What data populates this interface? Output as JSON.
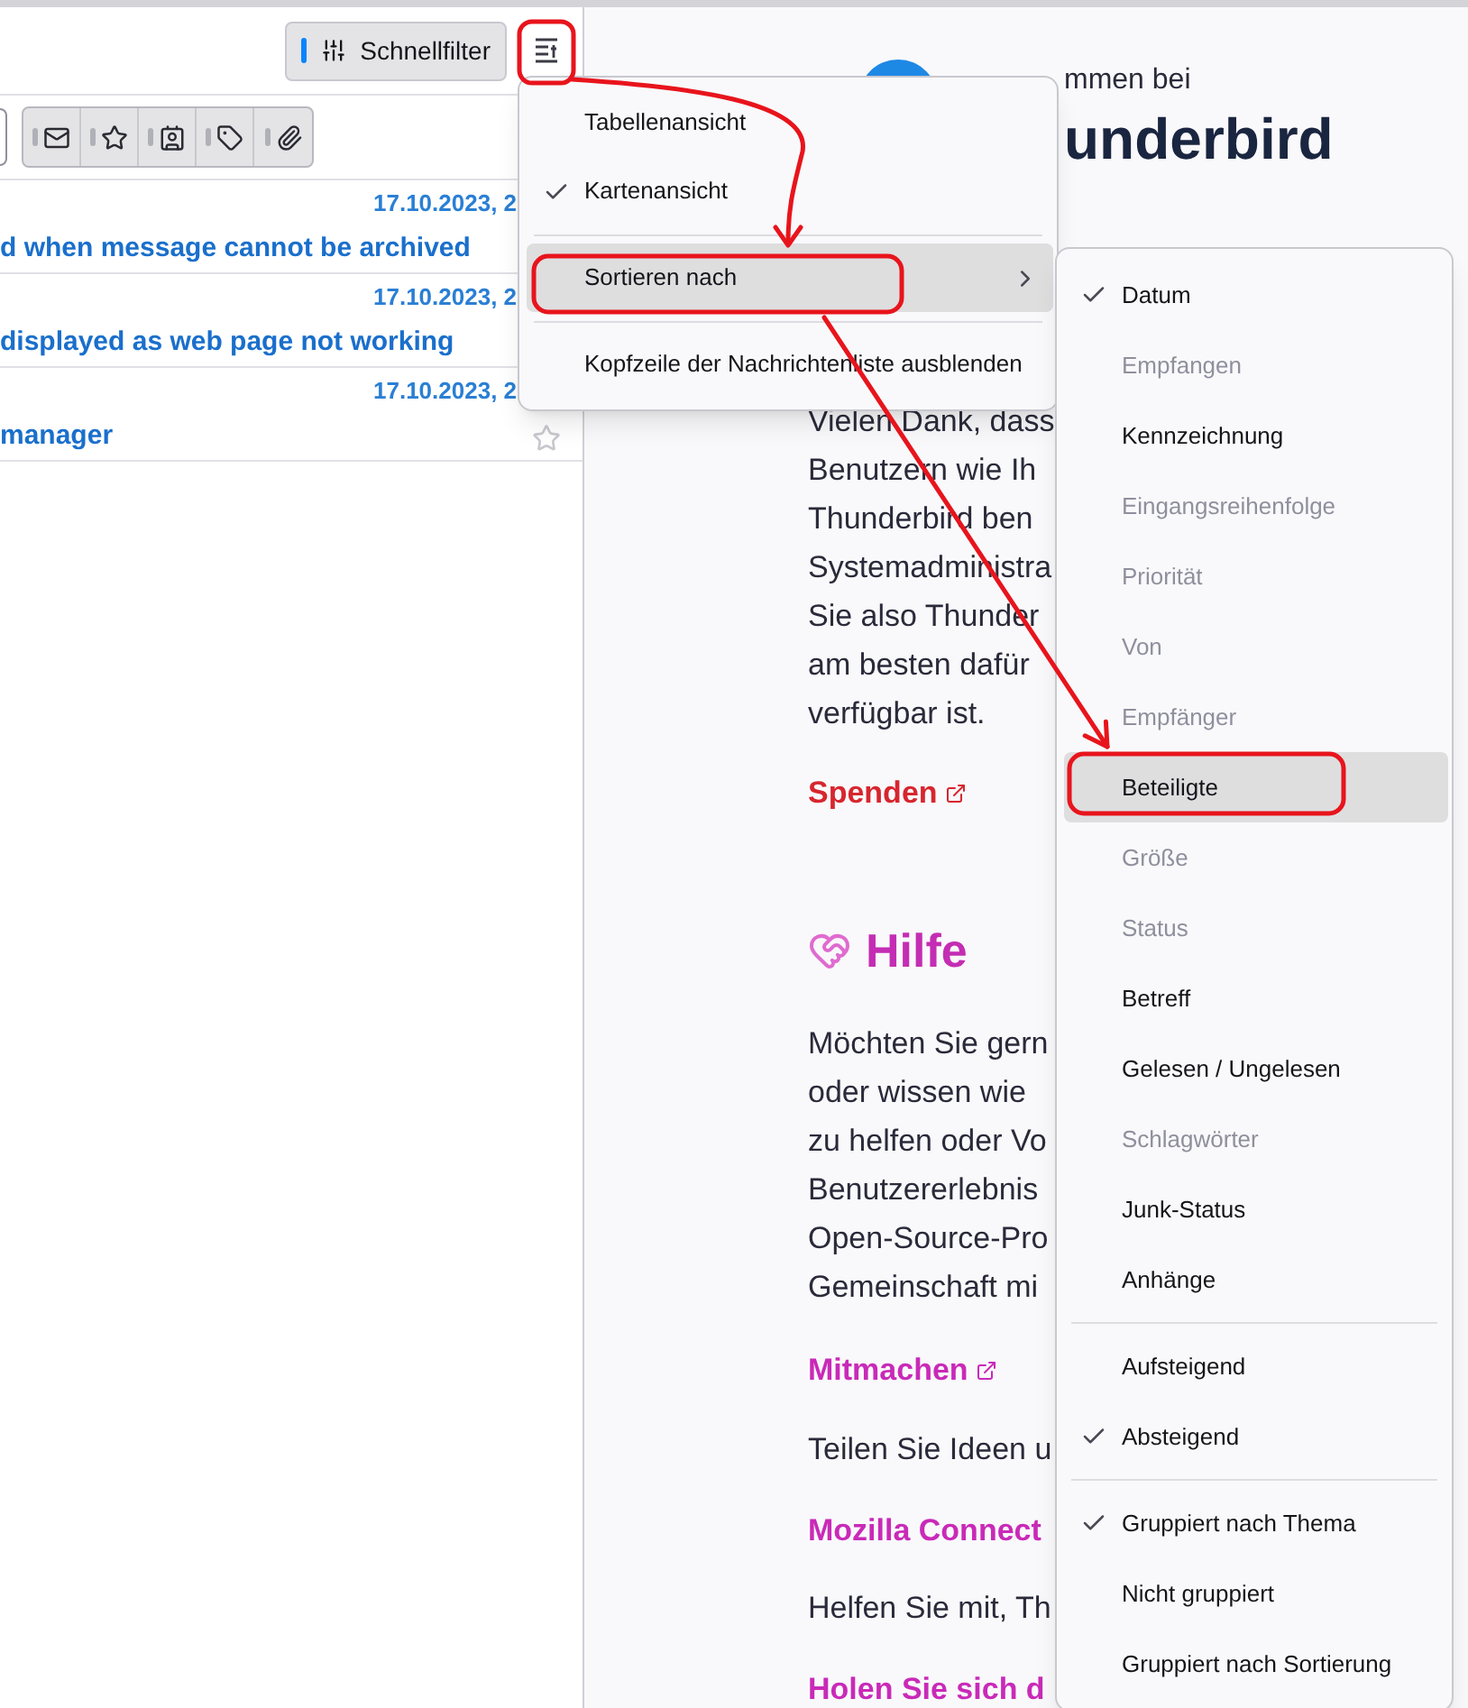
{
  "toolbar": {
    "quick_filter": "Schnellfilter"
  },
  "messages": [
    {
      "date": "17.10.2023, 2",
      "subject": "d when message cannot be archived"
    },
    {
      "date": "17.10.2023, 2",
      "subject": "displayed as web page not working"
    },
    {
      "date": "17.10.2023, 2",
      "subject": "manager",
      "hovered": true
    }
  ],
  "view_menu": {
    "items": [
      {
        "kind": "item",
        "label": "Tabellenansicht",
        "checked": false,
        "highlighted": false,
        "submenu": false
      },
      {
        "kind": "item",
        "label": "Kartenansicht",
        "checked": true,
        "highlighted": false,
        "submenu": false
      },
      {
        "kind": "separator"
      },
      {
        "kind": "item",
        "label": "Sortieren nach",
        "checked": false,
        "highlighted": true,
        "submenu": true
      },
      {
        "kind": "separator"
      },
      {
        "kind": "item",
        "label": "Kopfzeile der Nachrichtenliste ausblenden",
        "checked": false,
        "highlighted": false,
        "submenu": false
      }
    ]
  },
  "sort_menu": {
    "items": [
      {
        "kind": "item",
        "label": "Datum",
        "checked": true,
        "disabled": false,
        "highlighted": false
      },
      {
        "kind": "item",
        "label": "Empfangen",
        "checked": false,
        "disabled": true,
        "highlighted": false
      },
      {
        "kind": "item",
        "label": "Kennzeichnung",
        "checked": false,
        "disabled": false,
        "highlighted": false
      },
      {
        "kind": "item",
        "label": "Eingangsreihenfolge",
        "checked": false,
        "disabled": true,
        "highlighted": false
      },
      {
        "kind": "item",
        "label": "Priorität",
        "checked": false,
        "disabled": true,
        "highlighted": false
      },
      {
        "kind": "item",
        "label": "Von",
        "checked": false,
        "disabled": true,
        "highlighted": false
      },
      {
        "kind": "item",
        "label": "Empfänger",
        "checked": false,
        "disabled": true,
        "highlighted": false
      },
      {
        "kind": "item",
        "label": "Beteiligte",
        "checked": false,
        "disabled": false,
        "highlighted": true
      },
      {
        "kind": "item",
        "label": "Größe",
        "checked": false,
        "disabled": true,
        "highlighted": false
      },
      {
        "kind": "item",
        "label": "Status",
        "checked": false,
        "disabled": true,
        "highlighted": false
      },
      {
        "kind": "item",
        "label": "Betreff",
        "checked": false,
        "disabled": false,
        "highlighted": false
      },
      {
        "kind": "item",
        "label": "Gelesen / Ungelesen",
        "checked": false,
        "disabled": false,
        "highlighted": false
      },
      {
        "kind": "item",
        "label": "Schlagwörter",
        "checked": false,
        "disabled": true,
        "highlighted": false
      },
      {
        "kind": "item",
        "label": "Junk-Status",
        "checked": false,
        "disabled": false,
        "highlighted": false
      },
      {
        "kind": "item",
        "label": "Anhänge",
        "checked": false,
        "disabled": false,
        "highlighted": false
      },
      {
        "kind": "separator"
      },
      {
        "kind": "item",
        "label": "Aufsteigend",
        "checked": false,
        "disabled": false,
        "highlighted": false
      },
      {
        "kind": "item",
        "label": "Absteigend",
        "checked": true,
        "disabled": false,
        "highlighted": false
      },
      {
        "kind": "separator"
      },
      {
        "kind": "item",
        "label": "Gruppiert nach Thema",
        "checked": true,
        "disabled": false,
        "highlighted": false
      },
      {
        "kind": "item",
        "label": "Nicht gruppiert",
        "checked": false,
        "disabled": false,
        "highlighted": false
      },
      {
        "kind": "item",
        "label": "Gruppiert nach Sortierung",
        "checked": false,
        "disabled": false,
        "highlighted": false
      }
    ]
  },
  "welcome": {
    "greeting": "mmen bei",
    "title": "underbird"
  },
  "content": [
    {
      "kind": "paragraph",
      "lines": [
        "Vielen Dank, dass",
        "Benutzern wie Ih",
        "Thunderbird ben",
        "Systemadministra",
        "Sie also Thunder",
        "am besten dafür",
        "verfügbar ist."
      ]
    },
    {
      "kind": "link",
      "text": "Spenden",
      "color": "#d7262e",
      "external": true
    },
    {
      "kind": "heading",
      "text": "Hilfe"
    },
    {
      "kind": "paragraph",
      "lines": [
        "Möchten Sie gern",
        "oder wissen wie",
        "zu helfen oder Vo",
        "Benutzererlebnis",
        "Open-Source-Pro",
        "Gemeinschaft mi"
      ]
    },
    {
      "kind": "link",
      "text": "Mitmachen",
      "color": "#c92ab8",
      "external": true
    },
    {
      "kind": "paragraph",
      "lines": [
        "Teilen Sie Ideen u"
      ]
    },
    {
      "kind": "link",
      "text": "Mozilla Connect",
      "color": "#c92ab8",
      "external": false
    },
    {
      "kind": "paragraph",
      "lines": [
        "Helfen Sie mit, Th"
      ]
    },
    {
      "kind": "link",
      "text": "Holen Sie sich d",
      "color": "#c92ab8",
      "external": false
    }
  ]
}
